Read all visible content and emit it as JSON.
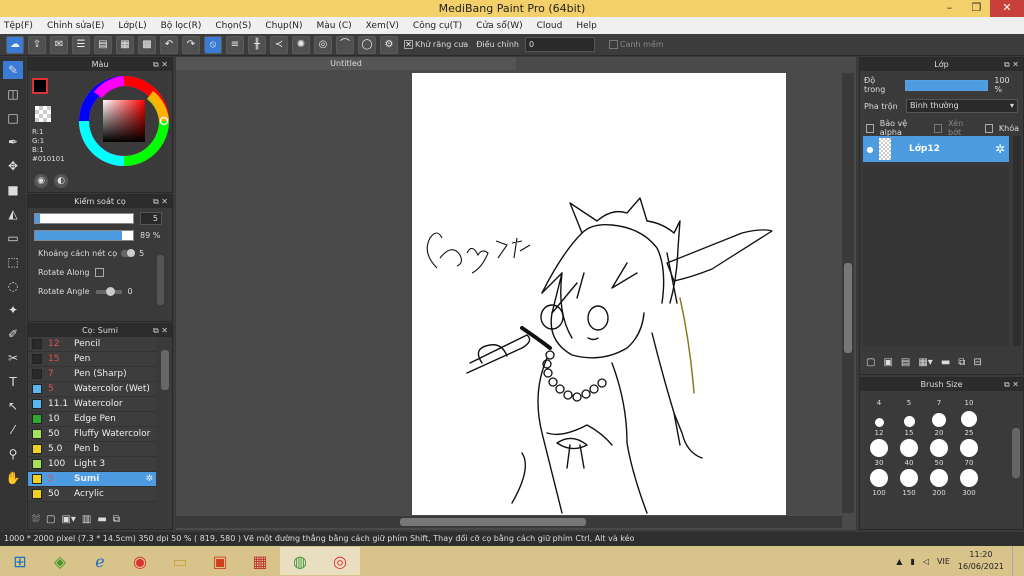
{
  "window": {
    "title": "MediBang Paint Pro (64bit)",
    "min": "–",
    "max": "❐",
    "close": "✕"
  },
  "menu": [
    "Tệp(F)",
    "Chỉnh sửa(E)",
    "Lớp(L)",
    "Bộ lọc(R)",
    "Chọn(S)",
    "Chụp(N)",
    "Màu (C)",
    "Xem(V)",
    "Công cụ(T)",
    "Cửa sổ(W)",
    "Cloud",
    "Help"
  ],
  "toolbar": {
    "antialias_label": "Khử răng cưa",
    "adjust_label": "Điều chỉnh",
    "adjust_value": "0",
    "smooth_label": "Canh mềm"
  },
  "color_panel": {
    "title": "Màu",
    "r": "R:1",
    "g": "G:1",
    "b": "B:1",
    "hex": "#010101",
    "current_color": "#010101"
  },
  "brush_control": {
    "title": "Kiểm soát cọ",
    "size": "5",
    "opacity": "89 %",
    "opacity_fraction": 0.89,
    "spacing_label": "Khoảng cách nét cọ",
    "spacing_value": "5",
    "rotate_along": "Rotate Along",
    "rotate_angle": "Rotate Angle",
    "rotate_value": "0"
  },
  "brush_list": {
    "title": "Cọ: Sumi",
    "items": [
      {
        "size": "12",
        "name": "Pencil",
        "color": "#2a2a2a"
      },
      {
        "size": "15",
        "name": "Pen",
        "color": "#2a2a2a"
      },
      {
        "size": "7",
        "name": "Pen (Sharp)",
        "color": "#2a2a2a"
      },
      {
        "size": "5",
        "name": "Watercolor (Wet)",
        "color": "#5ab8f0"
      },
      {
        "size": "11.1",
        "name": "Watercolor",
        "color": "#5ab8f0"
      },
      {
        "size": "10",
        "name": "Edge Pen",
        "color": "#2ea82e"
      },
      {
        "size": "50",
        "name": "Fluffy Watercolor",
        "color": "#a8e060"
      },
      {
        "size": "5.0",
        "name": "Pen b",
        "color": "#f0d020"
      },
      {
        "size": "100",
        "name": "Light 3",
        "color": "#a8e060"
      },
      {
        "size": "5",
        "name": "Sumi",
        "color": "#f0d020"
      },
      {
        "size": "50",
        "name": "Acrylic",
        "color": "#f0d020"
      }
    ]
  },
  "document": {
    "tab": "Untitled",
    "signature": "Cing 2k7"
  },
  "layer_panel": {
    "title": "Lớp",
    "opacity_label": "Độ trong",
    "opacity_value": "100 %",
    "blend_label": "Pha trộn",
    "blend_value": "Bình thường",
    "protect_alpha": "Bảo vệ alpha",
    "clipping": "Xén bớt",
    "lock": "Khóa",
    "layer_name": "Lớp12"
  },
  "brush_size_panel": {
    "title": "Brush Size",
    "sizes": [
      "4",
      "5",
      "7",
      "10",
      "12",
      "15",
      "20",
      "25",
      "30",
      "40",
      "50",
      "70",
      "100",
      "150",
      "200",
      "300"
    ]
  },
  "status": {
    "text": "1000 * 2000 pixel   (7.3 * 14.5cm)   350 dpi   50 %   ( 819, 580 )   Vẽ một đường thẳng bằng cách giữ phím Shift, Thay đổi cỡ cọ bằng cách giữ phím Ctrl, Alt và kéo"
  },
  "taskbar": {
    "lang": "VIE",
    "time": "11:20",
    "date": "16/06/2021"
  }
}
